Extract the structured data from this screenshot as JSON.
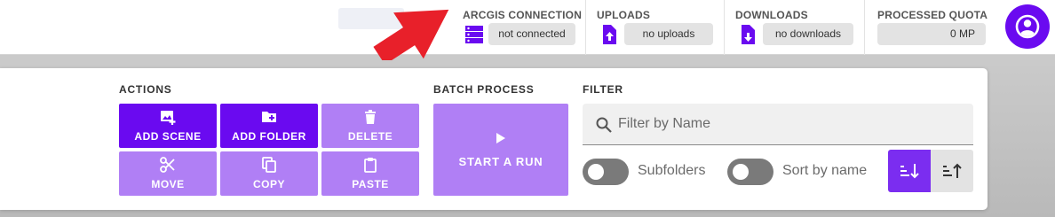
{
  "header": {
    "arcgis": {
      "title": "ARCGIS CONNECTION",
      "status": "not connected",
      "icon": "server-icon"
    },
    "uploads": {
      "title": "UPLOADS",
      "status": "no uploads",
      "icon": "file-upload-icon"
    },
    "downloads": {
      "title": "DOWNLOADS",
      "status": "no downloads",
      "icon": "file-download-icon"
    },
    "quota": {
      "title": "PROCESSED QUOTA",
      "value": "0 MP"
    },
    "avatar_icon": "account-circle-icon"
  },
  "annotation": {
    "icon": "red-arrow-icon",
    "color": "#e8202a"
  },
  "actions": {
    "label": "ACTIONS",
    "buttons": [
      {
        "label": "ADD SCENE",
        "icon": "add-image-icon",
        "style": "solid"
      },
      {
        "label": "ADD FOLDER",
        "icon": "add-folder-icon",
        "style": "solid"
      },
      {
        "label": "DELETE",
        "icon": "trash-icon",
        "style": "light"
      },
      {
        "label": "MOVE",
        "icon": "scissors-icon",
        "style": "light"
      },
      {
        "label": "COPY",
        "icon": "copy-icon",
        "style": "light"
      },
      {
        "label": "PASTE",
        "icon": "clipboard-icon",
        "style": "light"
      }
    ]
  },
  "batch": {
    "label": "BATCH PROCESS",
    "run_label": "START A RUN",
    "icon": "play-icon"
  },
  "filter": {
    "label": "FILTER",
    "search_placeholder": "Filter by Name",
    "search_value": "",
    "subfolders_label": "Subfolders",
    "subfolders_on": false,
    "sort_by_name_label": "Sort by name",
    "sort_by_name_on": false,
    "sort_options": [
      {
        "icon": "sort-descending-icon",
        "active": true
      },
      {
        "icon": "sort-ascending-icon",
        "active": false
      }
    ]
  },
  "colors": {
    "accent": "#6a0af0",
    "accent_light": "#b07ff5",
    "pill": "#e3e3e3"
  }
}
